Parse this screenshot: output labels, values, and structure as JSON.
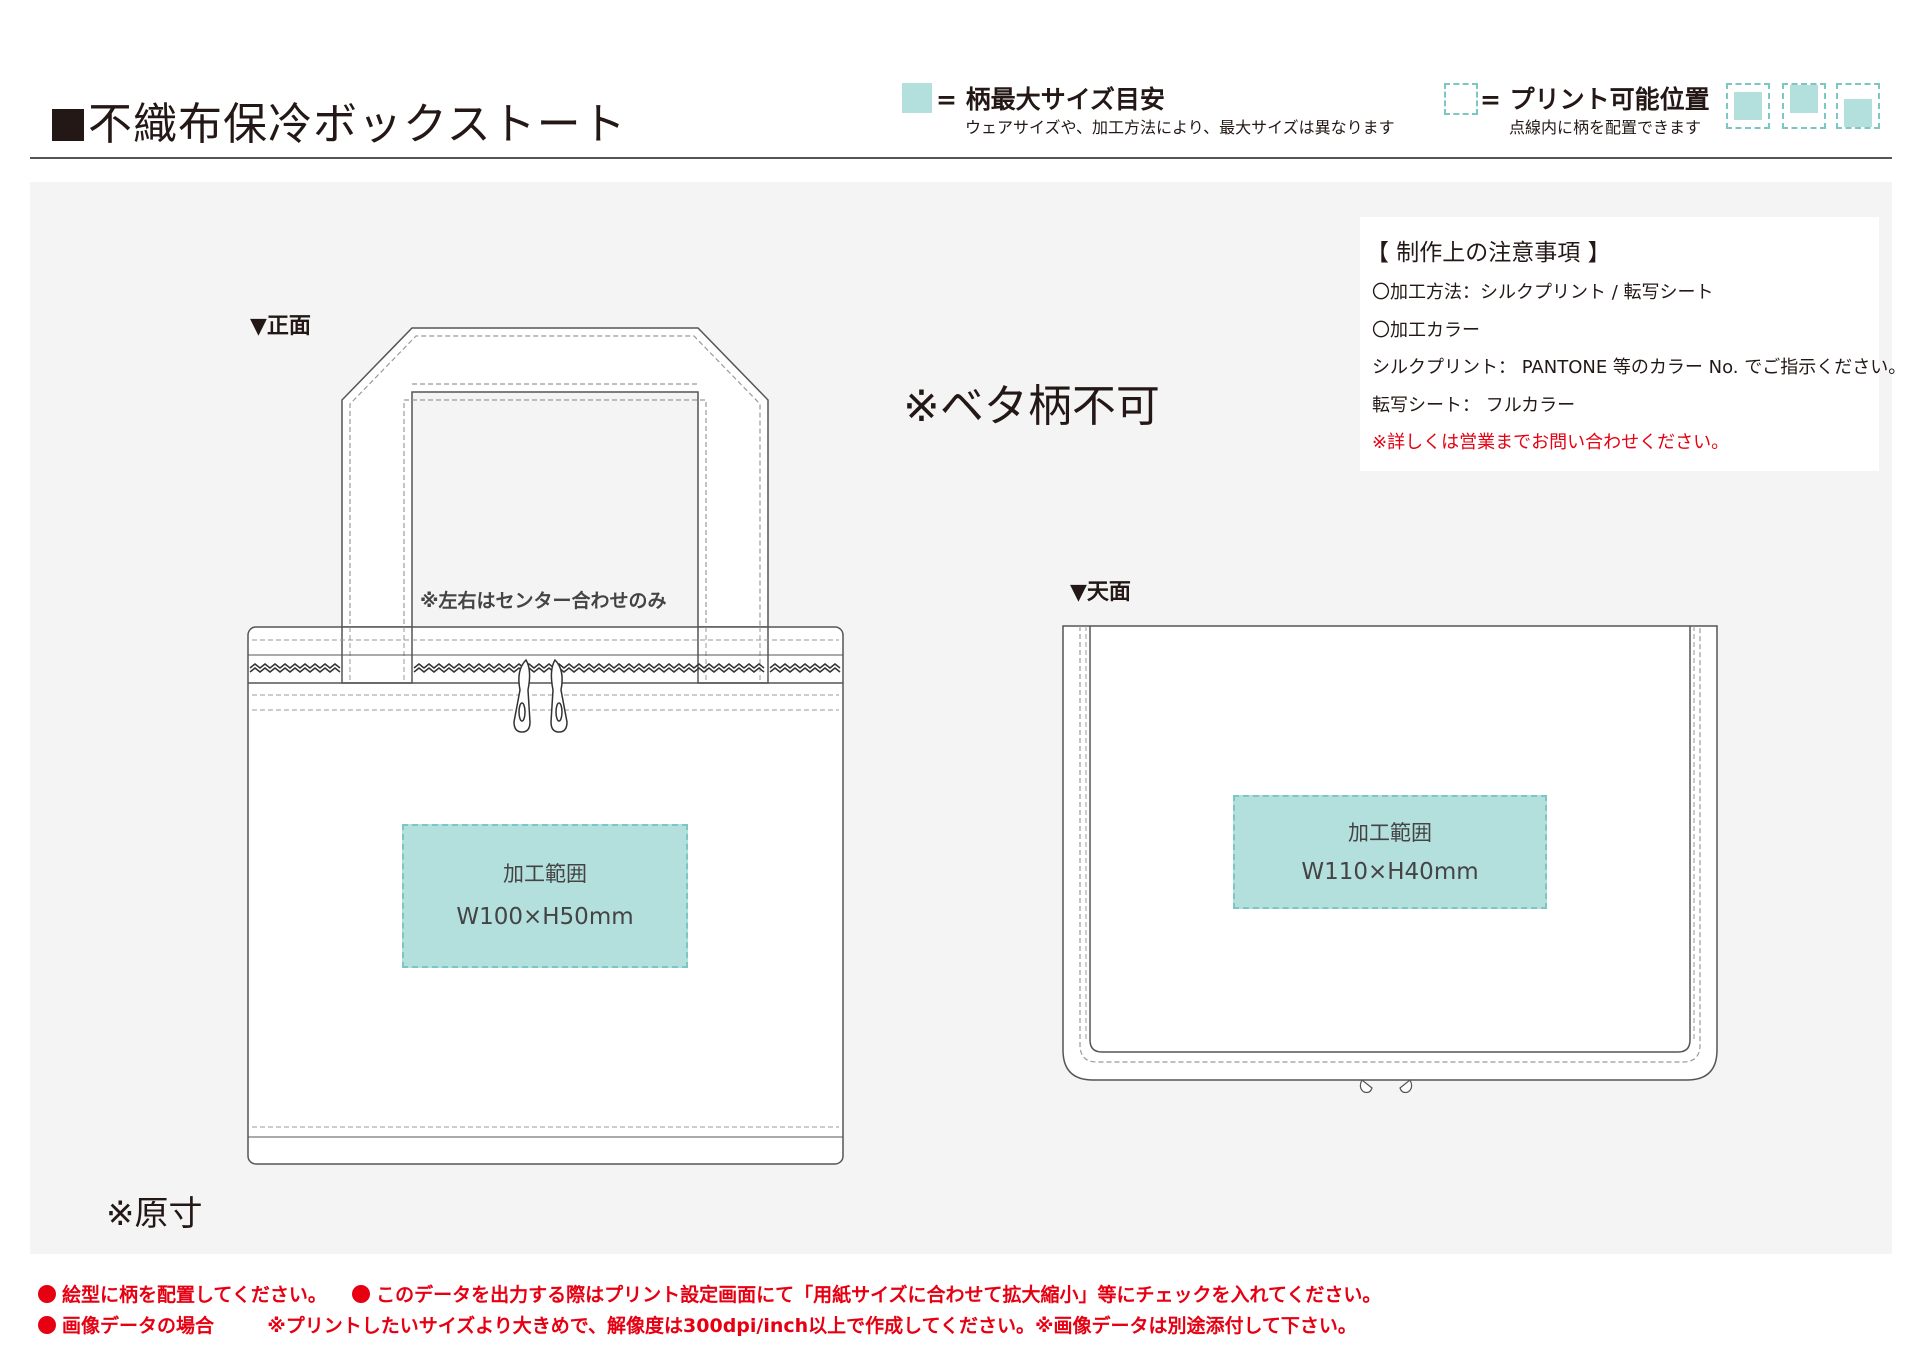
{
  "header": {
    "title": "不織布保冷ボックストート"
  },
  "legend": {
    "max_size_title": "= 柄最大サイズ目安",
    "max_size_note": "ウェアサイズや、加工方法により、最大サイズは異なります",
    "print_pos_title": "= プリント可能位置",
    "print_pos_note": "点線内に柄を配置できます",
    "swatch_color": "#b3dfdd",
    "dash_color": "#7cc7c3"
  },
  "notes": {
    "heading": "【 制作上の注意事項 】",
    "lines": [
      "〇加工方法：シルクプリント / 転写シート",
      "〇加工カラー",
      "シルクプリント： PANTONE 等のカラー No. でご指示ください。",
      "転写シート： フルカラー"
    ],
    "warning": "※詳しくは営業までお問い合わせください。"
  },
  "front": {
    "label": "▼正面",
    "center_note": "※左右はセンター合わせのみ",
    "area_label": "加工範囲",
    "area_size": "W100×H50mm"
  },
  "top_view": {
    "label": "▼天面",
    "area_label": "加工範囲",
    "area_size": "W110×H40mm"
  },
  "no_solid": "※ベタ柄不可",
  "actual_size": "※原寸",
  "footer": {
    "line1_a": "絵型に柄を配置してください。",
    "line1_b": "このデータを出力する際はプリント設定画面にて「用紙サイズに合わせて拡大縮小」等にチェックを入れてください。",
    "line2_a": "画像データの場合",
    "line2_b": "※プリントしたいサイズより大きめで、解像度は300dpi/inch以上で作成してください。※画像データは別途添付して下さい。",
    "accent_color": "#e60012"
  }
}
